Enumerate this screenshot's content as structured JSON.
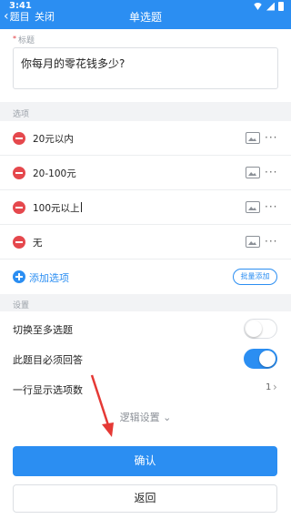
{
  "status_bar": {
    "time": "3:41",
    "icons": [
      "wifi-icon",
      "signal-icon",
      "battery-icon"
    ]
  },
  "nav": {
    "back_label": "题目",
    "close_label": "关闭",
    "title": "单选题"
  },
  "question": {
    "label": "标题",
    "required_mark": "*",
    "value": "你每月的零花钱多少?"
  },
  "options_section": {
    "label": "选项",
    "items": [
      {
        "text": "20元以内"
      },
      {
        "text": "20-100元"
      },
      {
        "text": "100元以上"
      },
      {
        "text": "无"
      }
    ],
    "more_glyph": "···",
    "add_label": "添加选项",
    "batch_add_label": "批量添加"
  },
  "settings_section": {
    "label": "设置",
    "multi_select": {
      "label": "切换至多选题",
      "on": false
    },
    "required": {
      "label": "此题目必须回答",
      "on": true
    },
    "per_row": {
      "label": "一行显示选项数",
      "value": "1"
    },
    "logic_label": "逻辑设置",
    "logic_chevron": "⌄"
  },
  "buttons": {
    "confirm": "确认",
    "back": "返回"
  },
  "colors": {
    "accent": "#2b8ef2",
    "remove": "#e5484d",
    "annotation_arrow": "#e53935"
  }
}
